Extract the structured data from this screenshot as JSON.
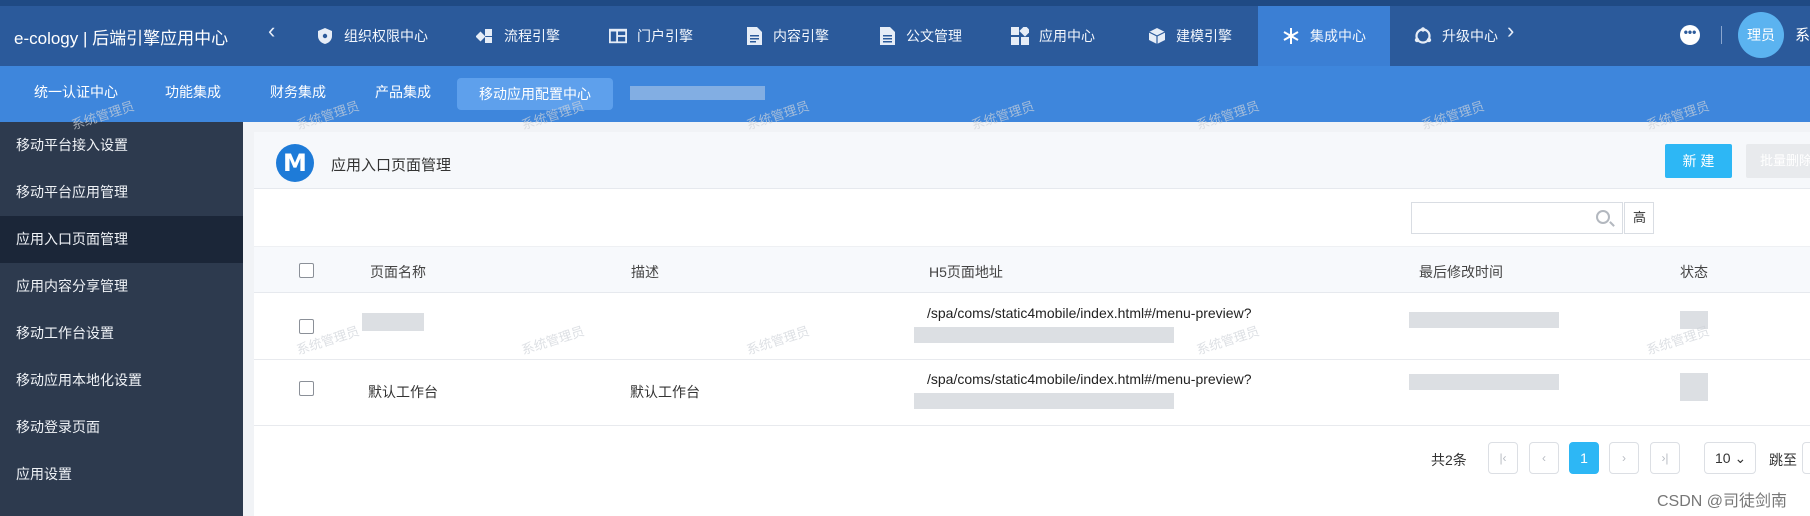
{
  "brand": "e-cology | 后端引擎应用中心",
  "top_nav": {
    "items": [
      {
        "label": "组织权限中心",
        "icon": "shield-icon"
      },
      {
        "label": "流程引擎",
        "icon": "flow-icon"
      },
      {
        "label": "门户引擎",
        "icon": "portal-icon"
      },
      {
        "label": "内容引擎",
        "icon": "document-icon"
      },
      {
        "label": "公文管理",
        "icon": "file-icon"
      },
      {
        "label": "应用中心",
        "icon": "apps-icon"
      },
      {
        "label": "建模引擎",
        "icon": "cube-icon"
      },
      {
        "label": "集成中心",
        "icon": "snowflake-icon"
      },
      {
        "label": "升级中心",
        "icon": "refresh-icon"
      }
    ],
    "active": "集成中心",
    "more_icon": "•••",
    "user_avatar": "理员",
    "user_name": "系"
  },
  "sub_nav": {
    "items": [
      "统一认证中心",
      "功能集成",
      "财务集成",
      "产品集成",
      "移动应用配置中心"
    ],
    "active": "移动应用配置中心"
  },
  "sidebar": {
    "items": [
      "移动平台接入设置",
      "移动平台应用管理",
      "应用入口页面管理",
      "应用内容分享管理",
      "移动工作台设置",
      "移动应用本地化设置",
      "移动登录页面",
      "应用设置"
    ],
    "active": "应用入口页面管理"
  },
  "panel": {
    "logo_letter": "M",
    "title": "应用入口页面管理",
    "new_button": "新 建",
    "batch_delete_button": "批量删除",
    "adv_button": "高"
  },
  "table": {
    "columns": [
      "页面名称",
      "描述",
      "H5页面地址",
      "最后修改时间",
      "状态"
    ],
    "rows": [
      {
        "name": "",
        "desc": "",
        "url": "/spa/coms/static4mobile/index.html#/menu-preview?"
      },
      {
        "name": "默认工作台",
        "desc": "默认工作台",
        "url": "/spa/coms/static4mobile/index.html#/menu-preview?"
      }
    ]
  },
  "pager": {
    "total": "共2条",
    "current_page": "1",
    "first": "|‹",
    "prev": "‹",
    "next": "›",
    "last": "›|",
    "page_size": "10",
    "jump_label": "跳至"
  },
  "watermark": "系统管理员",
  "credit": "CSDN @司徒剑南",
  "colors": {
    "topbar": "#2b5a9b",
    "subbar": "#3e86dc",
    "sidebar": "#2d3a4e",
    "accent": "#2db7f5"
  }
}
